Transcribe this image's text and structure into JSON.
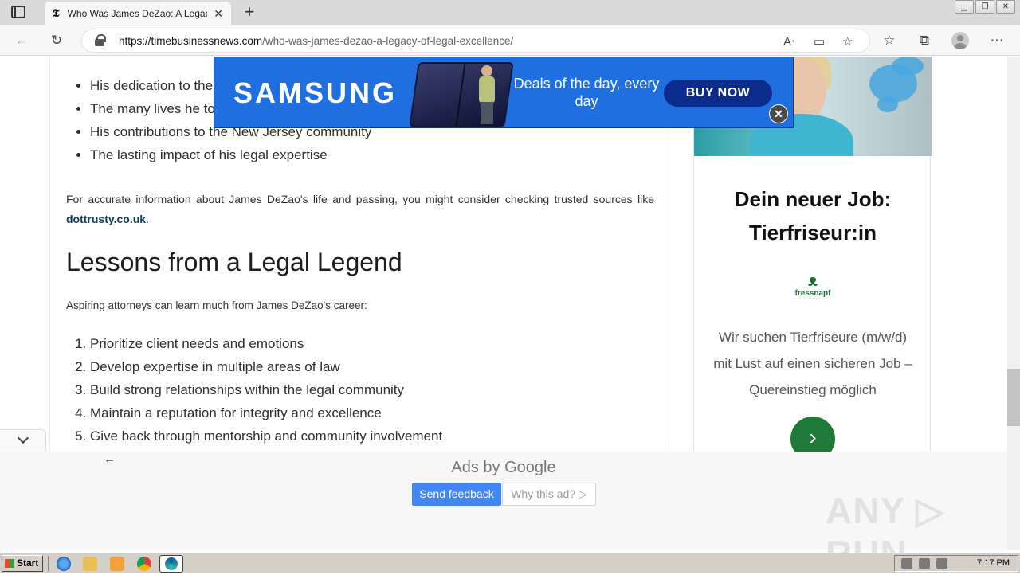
{
  "browser": {
    "tab_title": "Who Was James DeZao: A Legacy of Legal Excellence",
    "tab_close": "✕",
    "new_tab": "+",
    "url_domain": "https://timebusinessnews.com",
    "url_path": "/who-was-james-dezao-a-legacy-of-legal-excellence/",
    "favicon": "𝕿",
    "window_controls": [
      "▁",
      "❐",
      "✕"
    ]
  },
  "article": {
    "bullets": [
      "His dedication to the legal profession",
      "The many lives he touched through his work",
      "His contributions to the New Jersey community",
      "The lasting impact of his legal expertise"
    ],
    "para1_text": "For accurate information about James DeZao's life and passing, you might consider checking trusted sources like",
    "para1_link": "dottrusty.co.uk",
    "para1_end": ".",
    "heading": "Lessons from a Legal Legend",
    "intro": "Aspiring attorneys can learn much from James DeZao's career:",
    "lessons": [
      "Prioritize client needs and emotions",
      "Develop expertise in multiple areas of law",
      "Build strong relationships within the legal community",
      "Maintain a reputation for integrity and excellence",
      "Give back through mentorship and community involvement"
    ]
  },
  "sidebar_ad": {
    "headline": "Dein neuer Job: Tierfriseur:in",
    "logo_face": "ᴥ",
    "logo_name": "fressnapf",
    "body": "Wir suchen Tierfriseure (m/w/d) mit Lust auf einen sicheren Job – Quereinstieg möglich",
    "cta": "›"
  },
  "samsung_ad": {
    "brand": "SAMSUNG",
    "deal": "Deals of the day, every day",
    "buy": "BUY NOW",
    "close": "✕"
  },
  "anchor_ad": {
    "back": "←",
    "ads_by": "Ads by",
    "google": "Google",
    "send_feedback": "Send feedback",
    "why": "Why this ad? ▷",
    "watermark": "ANY ▷ RUN"
  },
  "taskbar": {
    "start": "Start",
    "clock": "7:17 PM"
  },
  "colors": {
    "samsung_blue": "#1f6fe0",
    "fressnapf_green": "#1e7a36",
    "google_blue": "#4285f4",
    "link": "#0b3d5f"
  }
}
